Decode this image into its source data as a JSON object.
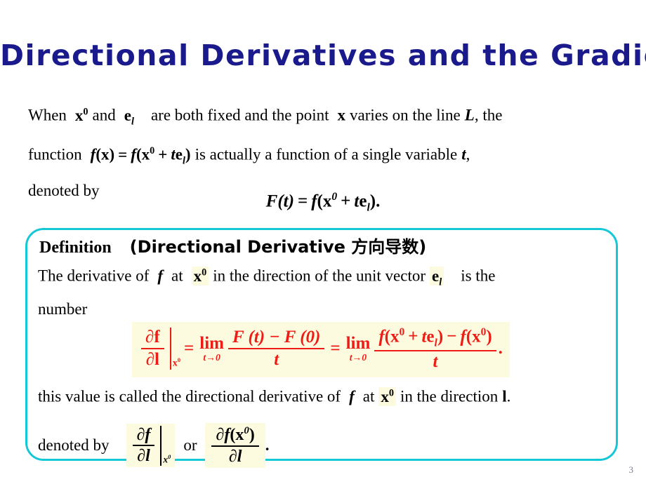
{
  "slide": {
    "title": "Directional Derivatives and the Gradient",
    "page_number": "3",
    "title_color": "#1a1a8c",
    "box_border_color": "#16c8d6",
    "highlight_color": "#fcfbe0",
    "equation_color": "#ee1c16"
  },
  "intro": {
    "line1_a": "When",
    "line1_x0": "x",
    "line1_x0_sup": "0",
    "line1_b": "and",
    "line1_e": "e",
    "line1_e_sub": "l",
    "line1_c": "are both fixed and the point",
    "line1_x": "x",
    "line1_d": "varies on the line",
    "line1_L": "L",
    "line1_e2": ", the",
    "line2_a": "function",
    "line2_f": "f",
    "line2_paren_x": "(x)",
    "line2_eq": "=",
    "line2_f2": "f",
    "line2_arg_open": "(x",
    "line2_arg_sup": "0",
    "line2_plus": "+",
    "line2_t": "t",
    "line2_e": "e",
    "line2_e_sub": "l",
    "line2_arg_close": ")",
    "line2_b": "is actually a function of a single variable",
    "line2_t2": "t",
    "line2_comma": ",",
    "line3": "denoted by"
  },
  "centered_equation": {
    "F": "F",
    "of_t": "(t)",
    "equals": "=",
    "f": "f",
    "open": "(x",
    "sup": "0",
    "plus": "+",
    "t": "t",
    "e": "e",
    "e_sub": "l",
    "close": ").",
    "plain": "F(t) = f(x0 + te_l)."
  },
  "definition": {
    "heading_label": "Definition",
    "heading_paren": "(Directional Derivative 方向导数)",
    "line1_a": "The derivative of",
    "line1_f": "f",
    "line1_b": "at",
    "line1_x": "x",
    "line1_x_sup": "0",
    "line1_c": "in the direction of the unit vector",
    "line1_e": "e",
    "line1_e_sub": "l",
    "line1_d": "is the",
    "line2": "number",
    "line3_a": "this value is called the directional derivative of",
    "line3_f": "f",
    "line3_b": "at",
    "line3_x": "x",
    "line3_x_sup": "0",
    "line3_c": "in the direction",
    "line3_l": "l",
    "line3_period": ".",
    "line4_a": "denoted by",
    "line4_or": "or",
    "line4_period": "."
  },
  "main_equation": {
    "lhs_num_partial": "∂f",
    "lhs_den_partial": "∂l",
    "lhs_eval_x": "x",
    "lhs_eval_sup": "0",
    "eq1": "=",
    "lim1_top": "lim",
    "lim1_bot": "t→0",
    "frac1_num": "F (t) − F (0)",
    "frac1_den": "t",
    "eq2": "=",
    "lim2_top": "lim",
    "lim2_bot": "t→0",
    "frac2_num_f": "f",
    "frac2_num_open": "(x",
    "frac2_num_sup": "0",
    "frac2_num_plus": "+",
    "frac2_num_t": "t",
    "frac2_num_e": "e",
    "frac2_num_e_sub": "l",
    "frac2_num_close": ")",
    "frac2_num_minus": "−",
    "frac2_num_f2": "f",
    "frac2_num_open2": "(x",
    "frac2_num_sup2": "0",
    "frac2_num_close2": ")",
    "frac2_den": "t",
    "trailing_period": "."
  },
  "denoted_forms": {
    "first_num": "∂f",
    "first_den": "∂l",
    "first_eval_x": "x",
    "first_eval_sup": "0",
    "second_num_partial": "∂f",
    "second_num_open": "(x",
    "second_num_sup": "0",
    "second_num_close": ")",
    "second_den": "∂l"
  }
}
